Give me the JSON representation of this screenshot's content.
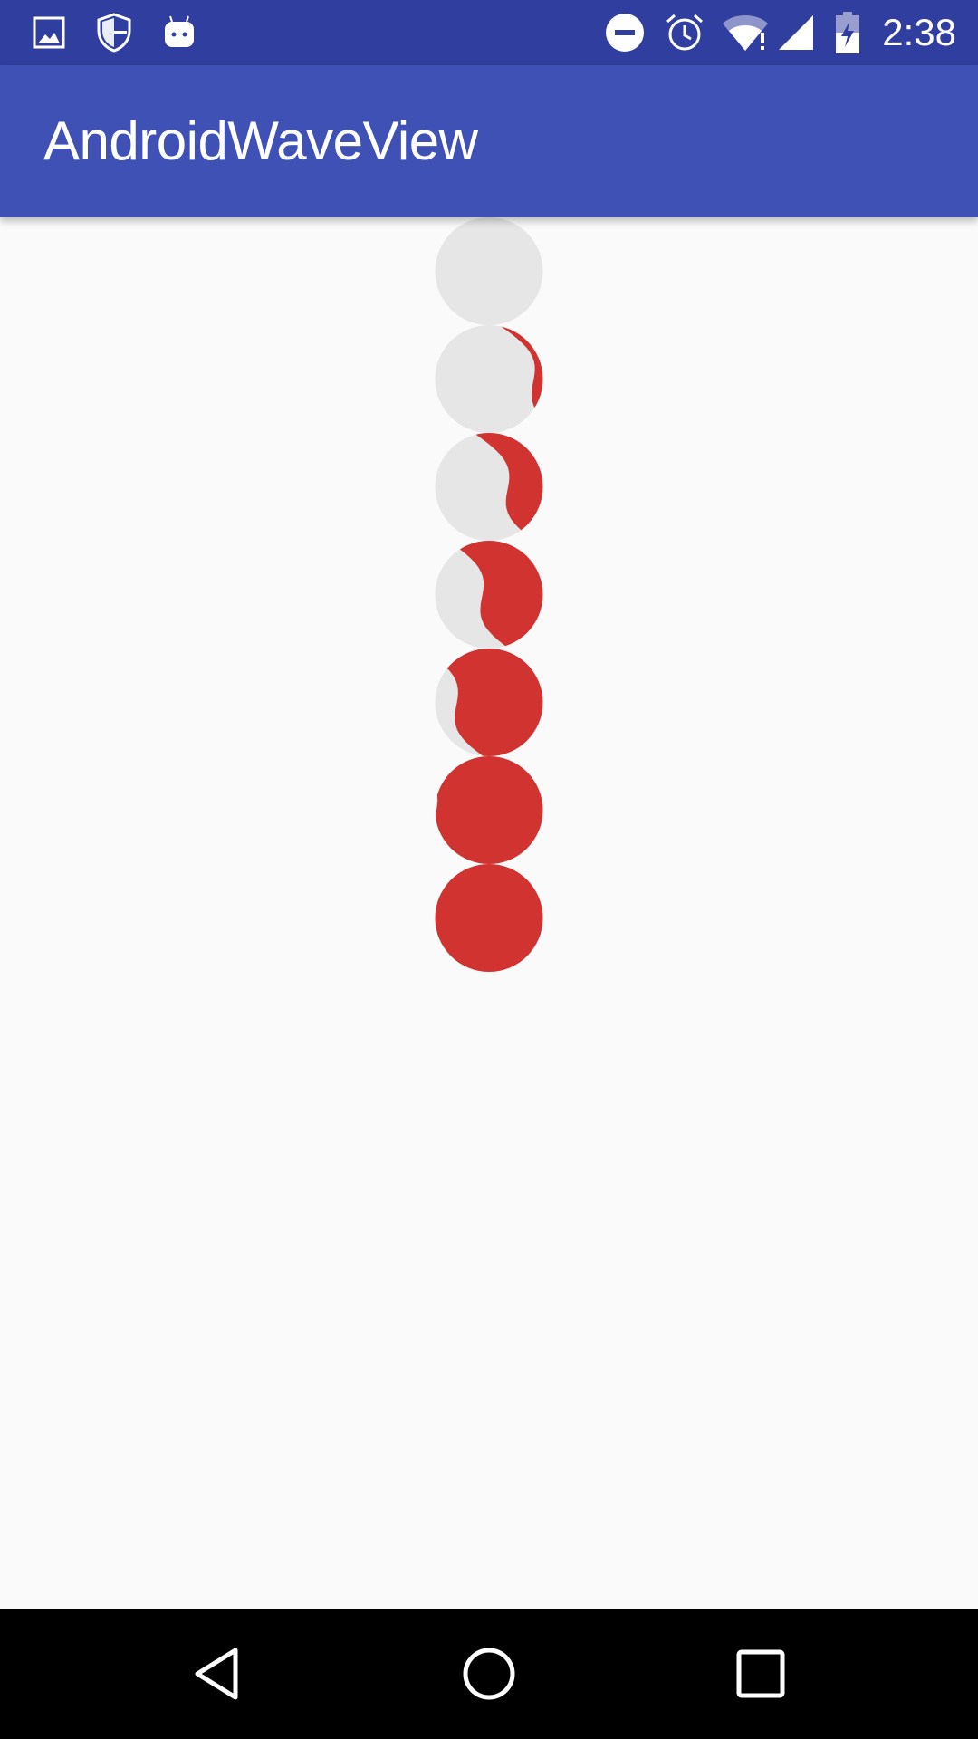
{
  "status_bar": {
    "time": "2:38",
    "left_icons": [
      "image-icon",
      "shield-icon",
      "android-icon"
    ],
    "right_icons": [
      "do-not-disturb-icon",
      "alarm-icon",
      "wifi-alert-icon",
      "cell-signal-icon",
      "battery-charging-icon"
    ],
    "background_color": "#303f9f"
  },
  "app_bar": {
    "title": "AndroidWaveView",
    "background_color": "#3f51b5"
  },
  "wave_views": {
    "wave_color": "#d03330",
    "base_color": "#e6e6e6",
    "items": [
      {
        "progress": 0.03
      },
      {
        "progress": 0.25
      },
      {
        "progress": 0.4
      },
      {
        "progress": 0.55
      },
      {
        "progress": 0.7
      },
      {
        "progress": 0.82
      },
      {
        "progress": 0.95
      }
    ]
  },
  "nav_bar": {
    "buttons": [
      "back-icon",
      "home-icon",
      "recents-icon"
    ],
    "background_color": "#000000"
  }
}
